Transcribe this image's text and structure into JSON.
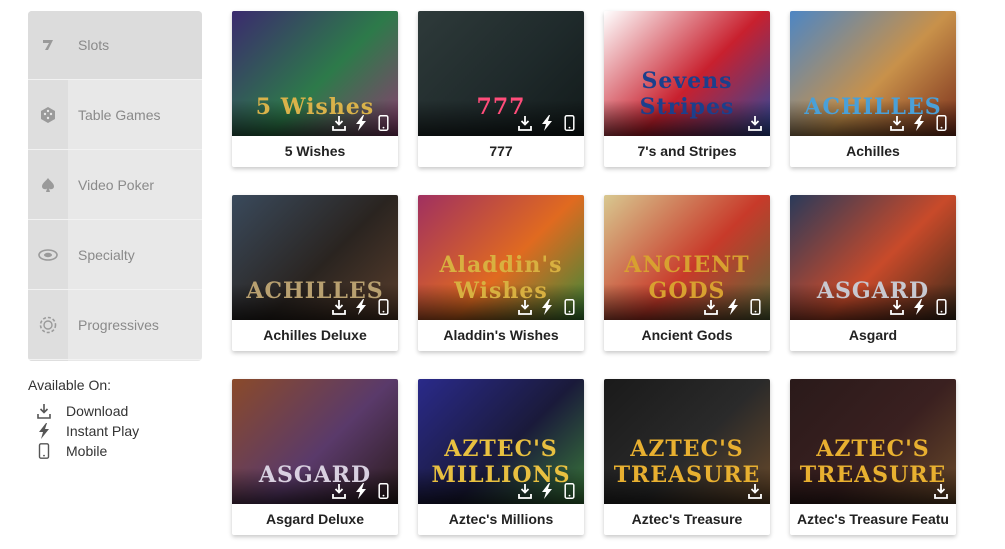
{
  "sidebar": {
    "categories": [
      {
        "label": "Slots",
        "icon": "seven-icon"
      },
      {
        "label": "Table Games",
        "icon": "dice-icon"
      },
      {
        "label": "Video Poker",
        "icon": "spade-icon"
      },
      {
        "label": "Specialty",
        "icon": "chip-icon"
      },
      {
        "label": "Progressives",
        "icon": "progressive-icon"
      }
    ],
    "active_index": 0
  },
  "available": {
    "title": "Available On:",
    "items": [
      {
        "label": "Download",
        "icon": "download-icon"
      },
      {
        "label": "Instant Play",
        "icon": "lightning-icon"
      },
      {
        "label": "Mobile",
        "icon": "mobile-icon"
      }
    ]
  },
  "games": [
    {
      "title": "5 Wishes",
      "logo": "5 Wishes",
      "logo_color": "#d9b24a",
      "colors": [
        "#3b2a6e",
        "#2d7a4a",
        "#8c3d70"
      ],
      "platforms": [
        "download",
        "instant",
        "mobile"
      ]
    },
    {
      "title": "777",
      "logo": "777",
      "logo_color": "#ff4d7a",
      "colors": [
        "#2e3a3a",
        "#1f2a2b",
        "#121a1a"
      ],
      "platforms": [
        "download",
        "instant",
        "mobile"
      ]
    },
    {
      "title": "7's and Stripes",
      "logo": "Sevens Stripes",
      "logo_color": "#1c3f8c",
      "colors": [
        "#ffffff",
        "#c8202e",
        "#2a4aa0"
      ],
      "platforms": [
        "download"
      ]
    },
    {
      "title": "Achilles",
      "logo": "ACHILLES",
      "logo_color": "#4aa0d8",
      "colors": [
        "#4d86c4",
        "#c8914a",
        "#7a2e1c"
      ],
      "platforms": [
        "download",
        "instant",
        "mobile"
      ]
    },
    {
      "title": "Achilles Deluxe",
      "logo": "ACHILLES",
      "logo_color": "#b8a070",
      "colors": [
        "#3a4a5c",
        "#2a2420",
        "#5a3e2c"
      ],
      "platforms": [
        "download",
        "instant",
        "mobile"
      ]
    },
    {
      "title": "Aladdin's Wishes",
      "logo": "Aladdin's Wishes",
      "logo_color": "#d8b040",
      "colors": [
        "#a03060",
        "#e06a20",
        "#3a8a3a"
      ],
      "platforms": [
        "download",
        "instant",
        "mobile"
      ]
    },
    {
      "title": "Ancient Gods",
      "logo": "ANCIENT GODS",
      "logo_color": "#d8a030",
      "colors": [
        "#d8c890",
        "#c83a2a",
        "#5a6a3a"
      ],
      "platforms": [
        "download",
        "instant",
        "mobile"
      ]
    },
    {
      "title": "Asgard",
      "logo": "ASGARD",
      "logo_color": "#c8c8d0",
      "colors": [
        "#2a3a5a",
        "#c84a2a",
        "#3a2a1a"
      ],
      "platforms": [
        "download",
        "instant",
        "mobile"
      ]
    },
    {
      "title": "Asgard Deluxe",
      "logo": "ASGARD",
      "logo_color": "#d8d0e0",
      "colors": [
        "#8a4a2a",
        "#5a3a6a",
        "#2a1a1a"
      ],
      "platforms": [
        "download",
        "instant",
        "mobile"
      ]
    },
    {
      "title": "Aztec's Millions",
      "logo": "AZTEC'S MILLIONS",
      "logo_color": "#e8c040",
      "colors": [
        "#2a2a8a",
        "#1a1a3a",
        "#3a7a3a"
      ],
      "platforms": [
        "download",
        "instant",
        "mobile"
      ]
    },
    {
      "title": "Aztec's Treasure",
      "logo": "AZTEC'S TREASURE",
      "logo_color": "#e8b030",
      "colors": [
        "#1a1a1a",
        "#2a2a2a",
        "#6a4a2a"
      ],
      "platforms": [
        "download"
      ]
    },
    {
      "title": "Aztec's Treasure Featu",
      "logo": "AZTEC'S TREASURE",
      "logo_color": "#e8b030",
      "colors": [
        "#2a1a1a",
        "#3a2020",
        "#6a4a2a"
      ],
      "platforms": [
        "download"
      ]
    }
  ]
}
